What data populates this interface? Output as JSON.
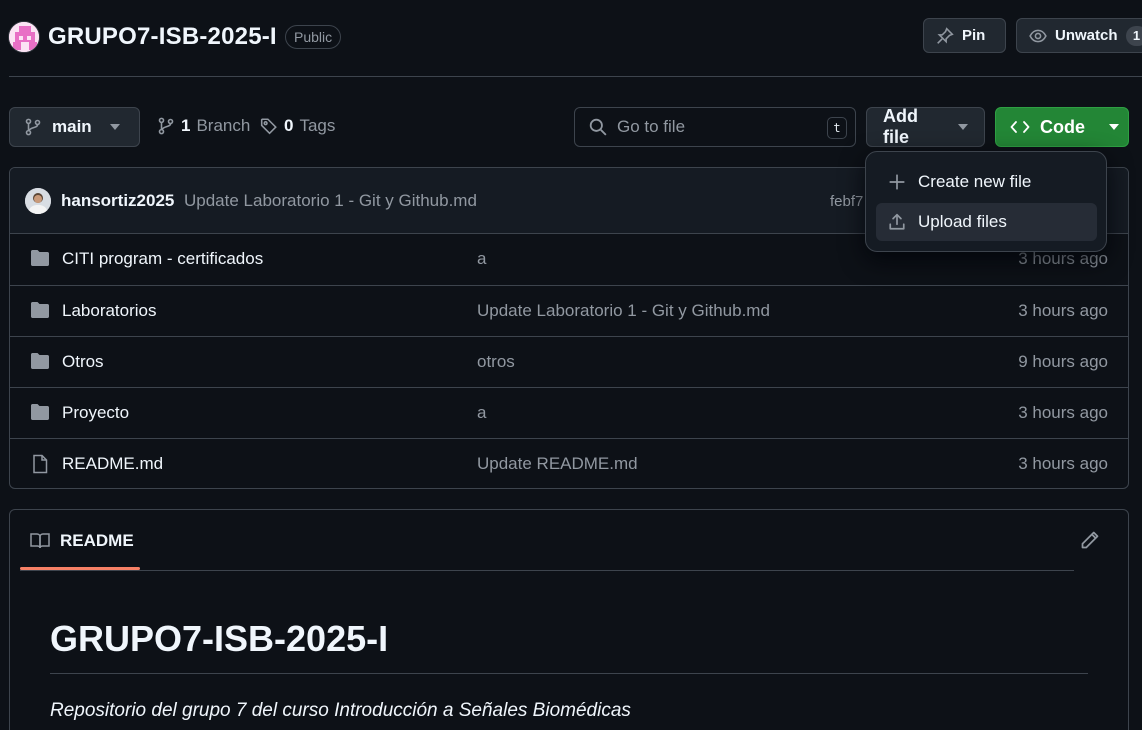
{
  "repo": {
    "name": "GRUPO7-ISB-2025-I",
    "visibility": "Public"
  },
  "header": {
    "pin_label": "Pin",
    "unwatch_label": "Unwatch",
    "watch_count": "1"
  },
  "toolbar": {
    "branch_name": "main",
    "branch_count": "1",
    "branch_label": "Branch",
    "tag_count": "0",
    "tag_label": "Tags",
    "search_placeholder": "Go to file",
    "search_shortcut": "t",
    "add_file_label": "Add file",
    "code_label": "Code"
  },
  "add_file_menu": {
    "items": [
      {
        "label": "Create new file",
        "icon": "plus-icon"
      },
      {
        "label": "Upload files",
        "icon": "upload-icon"
      }
    ]
  },
  "latest_commit": {
    "author": "hansortiz2025",
    "message": "Update Laboratorio 1 - Git y Github.md",
    "hash": "febf7"
  },
  "files": [
    {
      "type": "folder",
      "name": "CITI program - certificados",
      "message": "a",
      "time": "3 hours ago"
    },
    {
      "type": "folder",
      "name": "Laboratorios",
      "message": "Update Laboratorio 1 - Git y Github.md",
      "time": "3 hours ago"
    },
    {
      "type": "folder",
      "name": "Otros",
      "message": "otros",
      "time": "9 hours ago"
    },
    {
      "type": "folder",
      "name": "Proyecto",
      "message": "a",
      "time": "3 hours ago"
    },
    {
      "type": "file",
      "name": "README.md",
      "message": "Update README.md",
      "time": "3 hours ago"
    }
  ],
  "readme": {
    "tab_label": "README",
    "title": "GRUPO7-ISB-2025-I",
    "description": "Repositorio del grupo 7 del curso Introducción a Señales Biomédicas"
  },
  "colors": {
    "background": "#0d1117",
    "accent_green": "#238636",
    "tab_underline": "#f78166"
  }
}
